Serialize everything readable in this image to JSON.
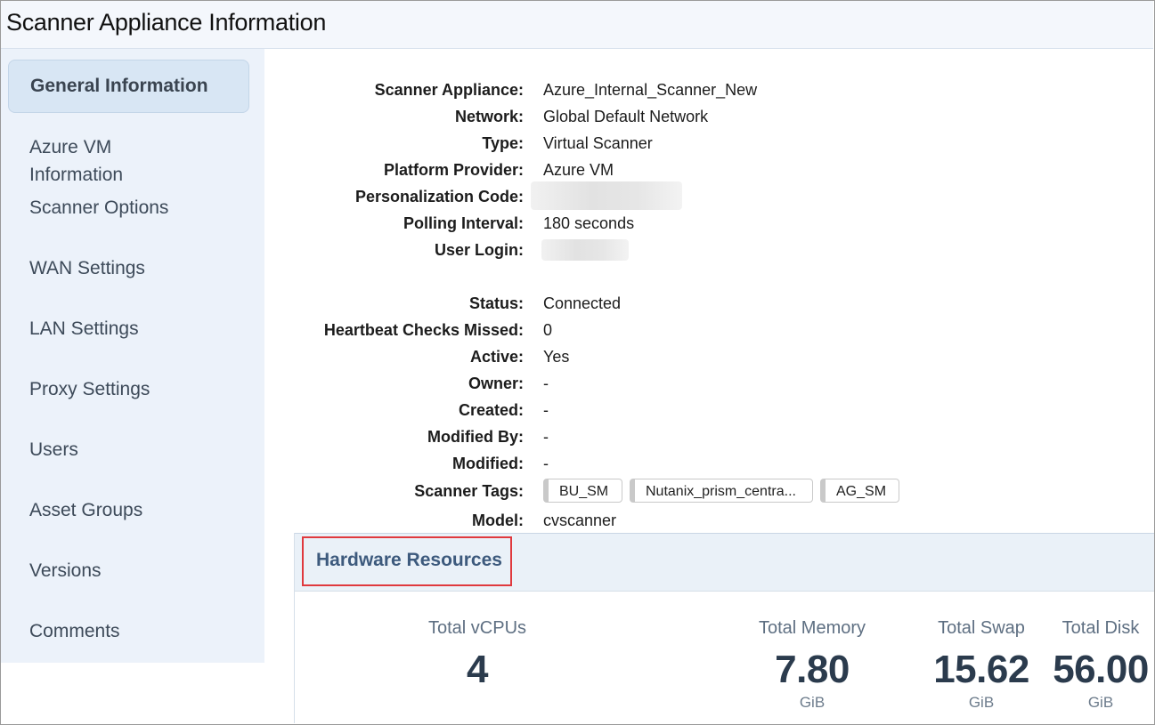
{
  "title": "Scanner Appliance Information",
  "sidebar": {
    "items": [
      {
        "label": "General Information",
        "active": true
      },
      {
        "label": "Azure VM\nInformation"
      },
      {
        "label": "Scanner Options"
      },
      {
        "label": "WAN Settings"
      },
      {
        "label": "LAN Settings"
      },
      {
        "label": "Proxy Settings"
      },
      {
        "label": "Users"
      },
      {
        "label": "Asset Groups"
      },
      {
        "label": "Versions"
      },
      {
        "label": "Comments"
      }
    ]
  },
  "info": {
    "scanner_appliance": {
      "label": "Scanner Appliance:",
      "value": "Azure_Internal_Scanner_New"
    },
    "network": {
      "label": "Network:",
      "value": "Global Default Network"
    },
    "type": {
      "label": "Type:",
      "value": "Virtual Scanner"
    },
    "platform_provider": {
      "label": "Platform Provider:",
      "value": "Azure VM"
    },
    "personalization_code": {
      "label": "Personalization Code:"
    },
    "polling_interval": {
      "label": "Polling Interval:",
      "value": "180 seconds"
    },
    "user_login": {
      "label": "User Login:"
    },
    "status": {
      "label": "Status:",
      "value": "Connected"
    },
    "heartbeat": {
      "label": "Heartbeat Checks Missed:",
      "value": "0"
    },
    "active": {
      "label": "Active:",
      "value": "Yes"
    },
    "owner": {
      "label": "Owner:",
      "value": "-"
    },
    "created": {
      "label": "Created:",
      "value": "-"
    },
    "modified_by": {
      "label": "Modified By:",
      "value": "-"
    },
    "modified": {
      "label": "Modified:",
      "value": "-"
    },
    "scanner_tags": {
      "label": "Scanner Tags:",
      "tags": [
        "BU_SM",
        "Nutanix_prism_centra...",
        "AG_SM"
      ]
    },
    "model": {
      "label": "Model:",
      "value": "cvscanner"
    }
  },
  "hardware": {
    "title": "Hardware Resources",
    "highlight_color": "#e0393e",
    "metrics": [
      {
        "label": "Total vCPUs",
        "value": "4",
        "unit": ""
      },
      {
        "label": "Total Memory",
        "value": "7.80",
        "unit": "GiB"
      },
      {
        "label": "Total Swap",
        "value": "15.62",
        "unit": "GiB"
      },
      {
        "label": "Total Disk",
        "value": "56.00",
        "unit": "GiB"
      }
    ]
  }
}
